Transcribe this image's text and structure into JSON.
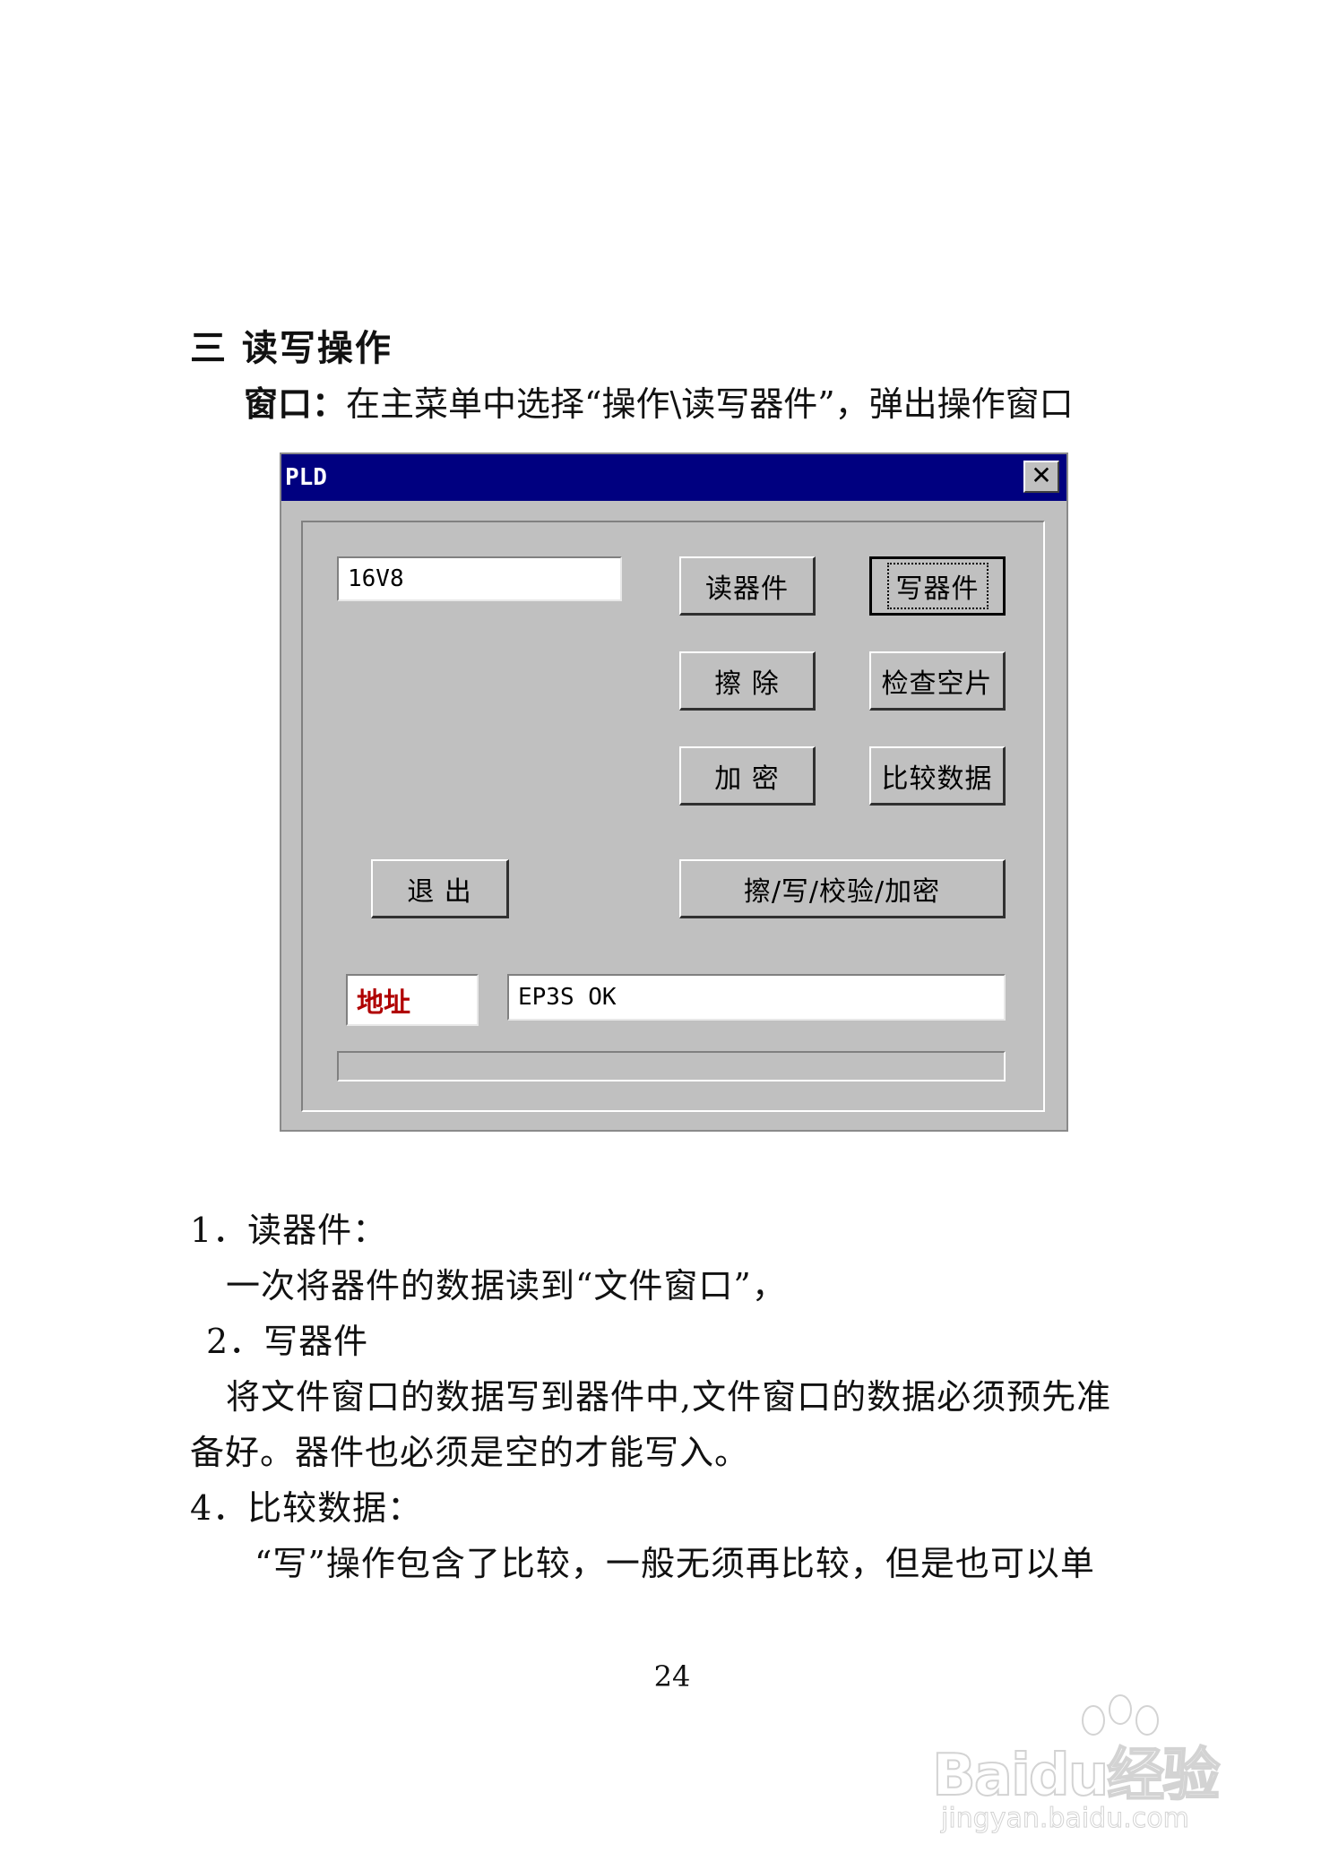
{
  "section": {
    "title": "三 读写操作"
  },
  "intro": {
    "lead": "窗口：",
    "text": "在主菜单中选择“操作\\读写器件”，弹出操作窗口"
  },
  "dialog": {
    "title": "PLD",
    "close_glyph": "✕",
    "device_field": "16V8",
    "buttons": {
      "read": "读器件",
      "write": "写器件",
      "erase": "擦 除",
      "blank_check": "检查空片",
      "encrypt": "加 密",
      "compare": "比较数据",
      "exit": "退 出",
      "auto": "擦/写/校验/加密"
    },
    "address_label": "地址",
    "status_field": "EP3S OK",
    "progress": 0
  },
  "body": {
    "item1_title": "1．读器件：",
    "item1_text": "一次将器件的数据读到“文件窗口”，",
    "item2_title": "2．写器件",
    "item2_text_line1": "将文件窗口的数据写到器件中,文件窗口的数据必须预先准",
    "item2_text_line2": "备好。器件也必须是空的才能写入。",
    "item4_title": "4．比较数据：",
    "item4_text": "“写”操作包含了比较，一般无须再比较，但是也可以单"
  },
  "page_number": "24",
  "watermark": {
    "brand": "Baidu经验",
    "url": "jingyan.baidu.com"
  }
}
